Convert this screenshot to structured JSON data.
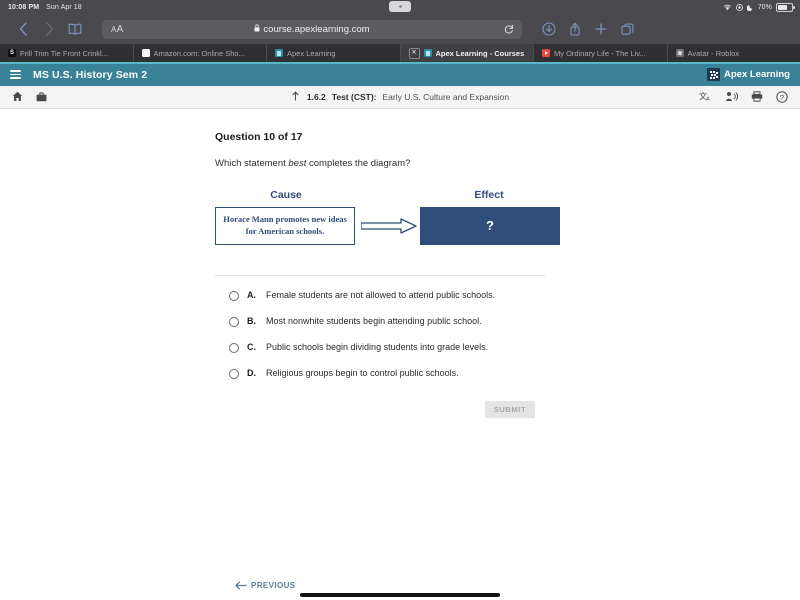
{
  "status_bar": {
    "time": "10:08 PM",
    "date": "Sun Apr 18",
    "battery_percent": "70%",
    "icons": [
      "wifi-icon",
      "screen-record-icon",
      "moon-icon",
      "battery-icon"
    ]
  },
  "browser": {
    "back_icon": "chevron-left-icon",
    "forward_icon": "chevron-right-icon",
    "bookmarks_icon": "book-icon",
    "url_text_size_label": "AA",
    "url": "course.apexlearning.com",
    "lock_icon": "lock-icon",
    "reload_icon": "reload-icon",
    "downloads_icon": "download-icon",
    "share_icon": "share-icon",
    "new_tab_icon": "plus-icon",
    "tabs_icon": "tabs-icon",
    "tabs": [
      {
        "label": "Frill Trim Tie Front Crinkl...",
        "favicon": "shein-favicon",
        "favicon_letter": "S",
        "active": false
      },
      {
        "label": "Amazon.com: Online Sho...",
        "favicon": "amazon-favicon",
        "favicon_letter": "a",
        "active": false
      },
      {
        "label": "Apex Learning",
        "favicon": "apex-favicon",
        "favicon_letter": "",
        "active": false
      },
      {
        "label": "Apex Learning - Courses",
        "favicon": "apex-favicon",
        "favicon_letter": "",
        "active": true,
        "close_icon": "close-icon"
      },
      {
        "label": "My Ordinary Life - The Liv...",
        "favicon": "youtube-favicon",
        "favicon_letter": "",
        "active": false
      },
      {
        "label": "Avatar - Roblox",
        "favicon": "roblox-favicon",
        "favicon_letter": "",
        "active": false
      }
    ]
  },
  "app_header": {
    "menu_icon": "hamburger-menu-icon",
    "course_title": "MS U.S. History Sem 2",
    "brand_name": "Apex Learning",
    "brand_icon": "apex-logo-icon"
  },
  "sub_nav": {
    "home_icon": "home-icon",
    "briefcase_icon": "briefcase-icon",
    "up_level_icon": "up-arrow-icon",
    "activity_number": "1.6.2",
    "activity_type": "Test (CST):",
    "activity_name": "Early U.S. Culture and Expansion",
    "translate_icon": "translate-icon",
    "read_aloud_icon": "read-aloud-icon",
    "print_icon": "print-icon",
    "help_icon": "help-icon"
  },
  "question": {
    "counter": "Question 10 of 17",
    "prompt_before": "Which statement ",
    "prompt_emphasis": "best",
    "prompt_after": " completes the diagram?"
  },
  "diagram": {
    "cause_label": "Cause",
    "effect_label": "Effect",
    "cause_text": "Horace Mann promotes new ideas for American schools.",
    "effect_text": "?",
    "arrow_icon": "right-arrow-icon",
    "accent_color": "#2e4d79"
  },
  "options": [
    {
      "letter": "A.",
      "text": "Female students are not allowed to attend public schools.",
      "selected": false
    },
    {
      "letter": "B.",
      "text": "Most nonwhite students begin attending public school.",
      "selected": false
    },
    {
      "letter": "C.",
      "text": "Public schools begin dividing students into grade levels.",
      "selected": false
    },
    {
      "letter": "D.",
      "text": "Religious groups begin to control public schools.",
      "selected": false
    }
  ],
  "actions": {
    "submit_label": "SUBMIT",
    "submit_enabled": false,
    "previous_label": "PREVIOUS",
    "previous_icon": "arrow-left-icon"
  },
  "colors": {
    "header_teal": "#3a8298",
    "diagram_navy": "#2e4d79",
    "link_blue": "#5b7f93"
  }
}
